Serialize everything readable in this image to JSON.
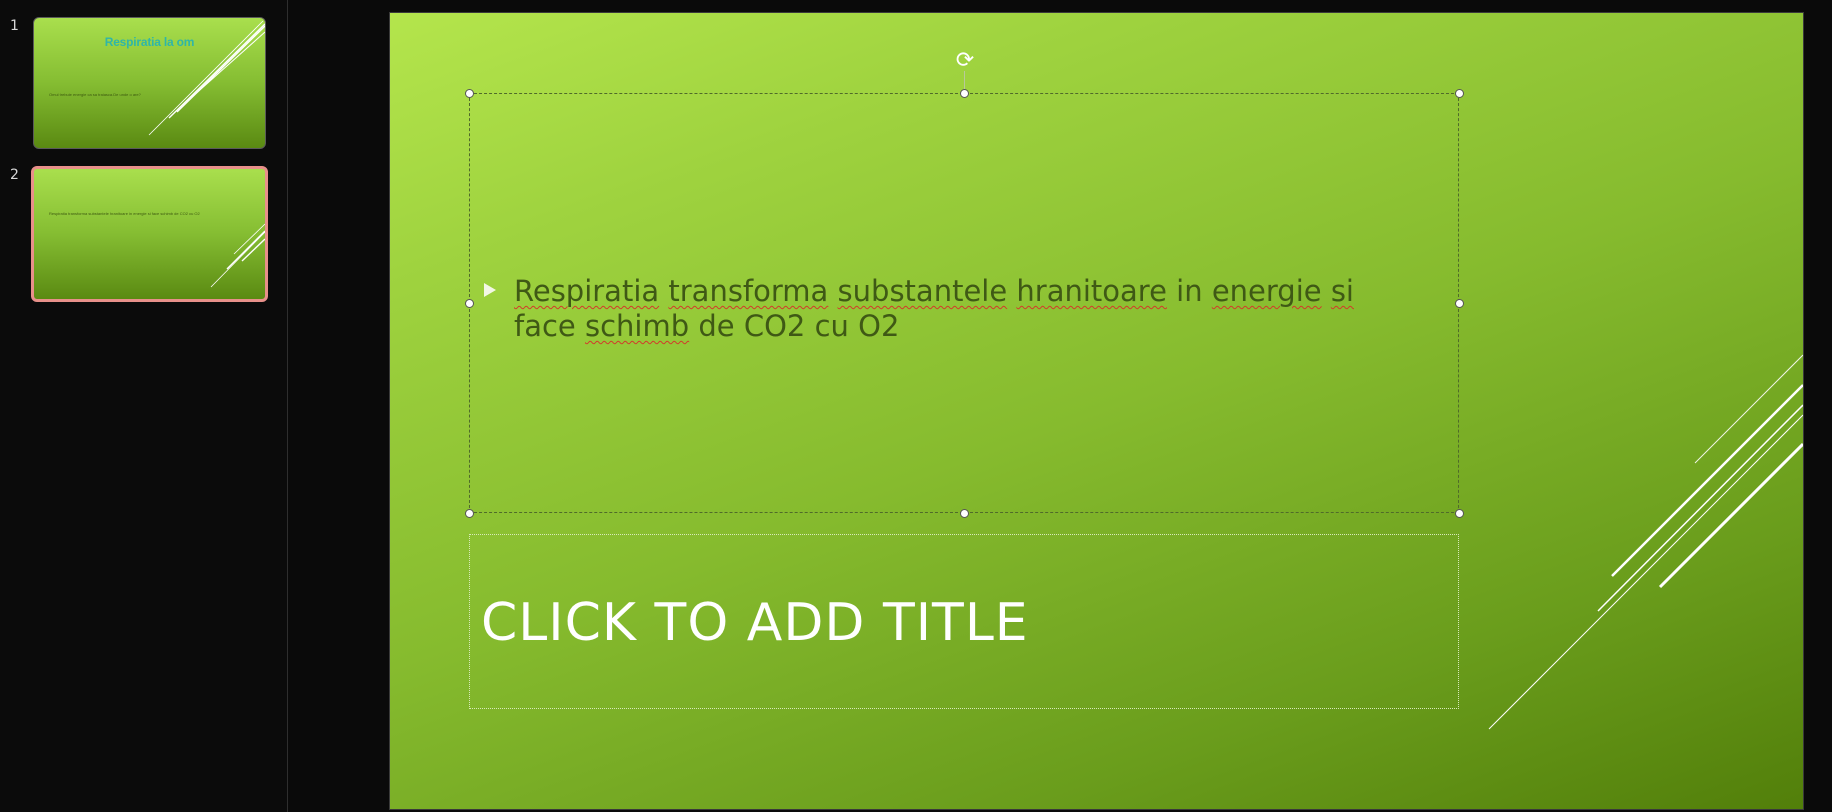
{
  "thumbnails": [
    {
      "number": "1",
      "title": "Respiratia la om",
      "body": "Omul trebuie energie ca sa traiasca.De unde o are?"
    },
    {
      "number": "2",
      "bullet": "Respiratia transforma substantele hranitoare in energie si face schimb de CO2 cu O2"
    }
  ],
  "slide": {
    "bullet_words": {
      "w1": "Respiratia",
      "w2": "transforma",
      "w3": "substantele",
      "w4": "hranitoare",
      "w5": "in",
      "w6": "energie",
      "w7": "si",
      "w8": "face",
      "w9": "schimb",
      "w10": "de CO2 cu O2"
    },
    "title_placeholder": "CLICK TO ADD TITLE"
  },
  "colors": {
    "selection_border": "#e8908a",
    "spellcheck_underline": "#d23a2a",
    "slide_gradient_top": "#b4e54c",
    "slide_gradient_bottom": "#527f0a"
  },
  "icons": {
    "rotate": "rotate-handle-icon",
    "bullet": "triangle-bullet-icon"
  }
}
